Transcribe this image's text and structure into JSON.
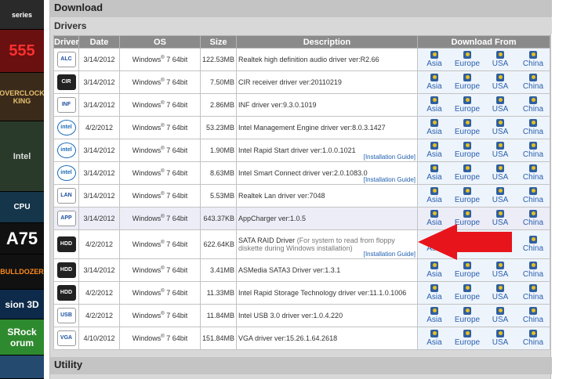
{
  "sidebar": {
    "ads": [
      "series",
      "555",
      "OVERCLOCK KING",
      "Intel",
      "CPU",
      "A75",
      "BULLDOZER",
      "sion 3D",
      "SRock orum"
    ]
  },
  "sections": {
    "download_title": "Download",
    "drivers_title": "Drivers",
    "utility_title": "Utility"
  },
  "table": {
    "headers": [
      "Driver",
      "Date",
      "OS",
      "Size",
      "Description",
      "Download From"
    ],
    "os_text": "Windows",
    "os_sup": "®",
    "os_rest": " 7 64bit",
    "mirrors": [
      "Asia",
      "Europe",
      "USA",
      "China"
    ],
    "guide_label": "[Installation Guide]",
    "rows": [
      {
        "icon": "realtek-audio-icon",
        "icon_text": "ALC",
        "date": "3/14/2012",
        "size": "122.53MB",
        "desc": "Realtek high definition audio driver ver:R2.66",
        "note": "",
        "guide": false
      },
      {
        "icon": "cir-receiver-icon",
        "icon_text": "CIR",
        "date": "3/14/2012",
        "size": "7.50MB",
        "desc": "CIR receiver driver ver:20110219",
        "note": "",
        "guide": false
      },
      {
        "icon": "inf-driver-icon",
        "icon_text": "INF",
        "date": "3/14/2012",
        "size": "2.86MB",
        "desc": "INF driver ver:9.3.0.1019",
        "note": "",
        "guide": false
      },
      {
        "icon": "intel-icon",
        "icon_text": "intel",
        "date": "4/2/2012",
        "size": "53.23MB",
        "desc": "Intel Management Engine driver ver:8.0.3.1427",
        "note": "",
        "guide": false
      },
      {
        "icon": "intel-icon",
        "icon_text": "intel",
        "date": "3/14/2012",
        "size": "1.90MB",
        "desc": "Intel Rapid Start driver ver:1.0.0.1021",
        "note": "",
        "guide": true
      },
      {
        "icon": "intel-icon",
        "icon_text": "intel",
        "date": "3/14/2012",
        "size": "8.63MB",
        "desc": "Intel Smart Connect driver ver:2.0.1083.0",
        "note": "",
        "guide": true
      },
      {
        "icon": "lan-icon",
        "icon_text": "LAN",
        "date": "3/14/2012",
        "size": "5.53MB",
        "desc": "Realtek Lan driver ver:7048",
        "note": "",
        "guide": false
      },
      {
        "icon": "app-charger-icon",
        "icon_text": "APP",
        "date": "3/14/2012",
        "size": "643.37KB",
        "desc": "AppCharger ver:1.0.5",
        "note": "",
        "guide": false
      },
      {
        "icon": "hdd-icon",
        "icon_text": "HDD",
        "date": "4/2/2012",
        "size": "622.64KB",
        "desc": "SATA RAID Driver",
        "note": " (For system to read from floppy diskette during Windows installation)",
        "guide": true
      },
      {
        "icon": "hdd-icon",
        "icon_text": "HDD",
        "date": "3/14/2012",
        "size": "3.41MB",
        "desc": "ASMedia SATA3 Driver ver:1.3.1",
        "note": "",
        "guide": false
      },
      {
        "icon": "hdd-icon",
        "icon_text": "HDD",
        "date": "4/2/2012",
        "size": "11.33MB",
        "desc": "Intel Rapid Storage Technology driver ver:11.1.0.1006",
        "note": "",
        "guide": false
      },
      {
        "icon": "usb-icon",
        "icon_text": "USB",
        "date": "4/2/2012",
        "size": "11.84MB",
        "desc": "Intel USB 3.0 driver ver:1.0.4.220",
        "note": "",
        "guide": false
      },
      {
        "icon": "vga-icon",
        "icon_text": "VGA",
        "date": "4/10/2012",
        "size": "151.84MB",
        "desc": "VGA driver ver:15.26.1.64.2618",
        "note": "",
        "guide": false
      }
    ]
  },
  "colors": {
    "header_bg": "#8a8a8a",
    "link": "#2a60b0",
    "arrow": "#e8141c"
  }
}
